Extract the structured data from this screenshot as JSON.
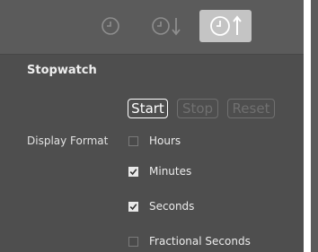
{
  "section": {
    "title": "Stopwatch"
  },
  "toolbar": {
    "buttons": [
      {
        "icon": "clock-icon",
        "active": false
      },
      {
        "icon": "clock-down-arrow-icon",
        "active": false
      },
      {
        "icon": "clock-up-arrow-icon",
        "active": true
      }
    ]
  },
  "controls": {
    "start_label": "Start",
    "stop_label": "Stop",
    "reset_label": "Reset"
  },
  "display_format": {
    "label": "Display Format",
    "options": [
      {
        "label": "Hours",
        "checked": false
      },
      {
        "label": "Minutes",
        "checked": true
      },
      {
        "label": "Seconds",
        "checked": true
      },
      {
        "label": "Fractional Seconds",
        "checked": false
      }
    ]
  },
  "colors": {
    "panel_bg": "#5b5b5b",
    "section_bg": "#4e4e4e",
    "active_button_bg": "#c4c4c4",
    "enabled_text": "#ffffff",
    "disabled_text": "#707070"
  }
}
